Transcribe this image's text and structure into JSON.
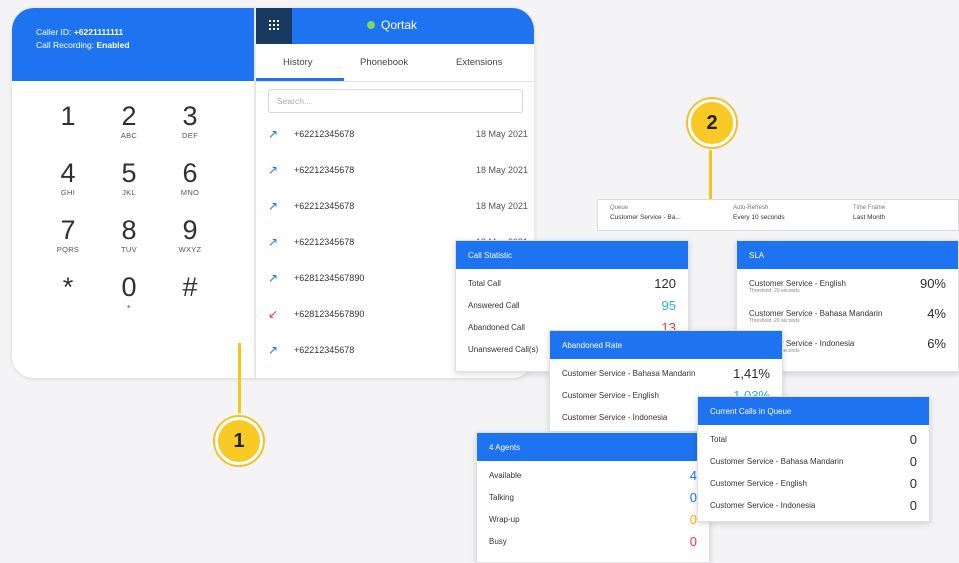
{
  "dialer": {
    "caller_id_label": "Caller ID:",
    "caller_id_value": "+6221111111",
    "recording_label": "Call Recording:",
    "recording_value": "Enabled",
    "keys": [
      {
        "n": "1",
        "l": ""
      },
      {
        "n": "2",
        "l": "ABC"
      },
      {
        "n": "3",
        "l": "DEF"
      },
      {
        "n": "4",
        "l": "GHI"
      },
      {
        "n": "5",
        "l": "JKL"
      },
      {
        "n": "6",
        "l": "MNO"
      },
      {
        "n": "7",
        "l": "PQRS"
      },
      {
        "n": "8",
        "l": "TUV"
      },
      {
        "n": "9",
        "l": "WXYZ"
      },
      {
        "n": "*",
        "l": ""
      },
      {
        "n": "0",
        "l": "+"
      },
      {
        "n": "#",
        "l": ""
      }
    ]
  },
  "app": {
    "brand": "Qortak"
  },
  "tabs": [
    "History",
    "Phonebook",
    "Extensions"
  ],
  "search": {
    "placeholder": "Search..."
  },
  "history": [
    {
      "type": "out",
      "number": "+62212345678",
      "date": "18 May 2021"
    },
    {
      "type": "out",
      "number": "+62212345678",
      "date": "18 May 2021"
    },
    {
      "type": "out",
      "number": "+62212345678",
      "date": "18 May 2021"
    },
    {
      "type": "out",
      "number": "+62212345678",
      "date": "18 May 2021"
    },
    {
      "type": "out",
      "number": "+6281234567890",
      "date": ""
    },
    {
      "type": "missed",
      "number": "+6281234567890",
      "date": ""
    },
    {
      "type": "out",
      "number": "+62212345678",
      "date": ""
    }
  ],
  "badges": {
    "one": "1",
    "two": "2"
  },
  "filters": {
    "queue_label": "Queue",
    "queue_value": "Customer Service - Ba...",
    "refresh_label": "Auto-Refresh",
    "refresh_value": "Every 10 seconds",
    "time_label": "Time Frame",
    "time_value": "Last Month"
  },
  "cards": {
    "call_statistic": {
      "title": "Call Statistic",
      "rows": [
        {
          "label": "Total Call",
          "value": "120",
          "color": "#2b2b2b"
        },
        {
          "label": "Answered Call",
          "value": "95",
          "color": "#2ab3c8"
        },
        {
          "label": "Abandoned Call",
          "value": "13",
          "color": "#e53935"
        },
        {
          "label": "Unanswered Call(s)",
          "value": "",
          "color": "#2b2b2b"
        }
      ]
    },
    "sla": {
      "title": "SLA",
      "rows": [
        {
          "label": "Customer Service - English",
          "sub": "Threshold: 20 seconds",
          "value": "90%"
        },
        {
          "label": "Customer Service - Bahasa Mandarin",
          "sub": "Threshold: 20 seconds",
          "value": "4%"
        },
        {
          "label": "Customer Service - Indonesia",
          "sub": "Threshold: 20 seconds",
          "value": "6%"
        }
      ]
    },
    "abandoned_rate": {
      "title": "Abandoned Rate",
      "rows": [
        {
          "label": "Customer Service - Bahasa Mandarin",
          "value": "1,41%",
          "color": "#2b2b2b"
        },
        {
          "label": "Customer Service - English",
          "value": "1,03%",
          "color": "#2ab3c8"
        },
        {
          "label": "Customer Service - Indonesia",
          "value": "",
          "color": "#2b2b2b"
        }
      ]
    },
    "agents": {
      "title": "4 Agents",
      "rows": [
        {
          "label": "Available",
          "value": "4",
          "color": "#1e73f0"
        },
        {
          "label": "Talking",
          "value": "0",
          "color": "#1e73f0"
        },
        {
          "label": "Wrap-up",
          "value": "0",
          "color": "#f5b400"
        },
        {
          "label": "Busy",
          "value": "0",
          "color": "#e53935"
        }
      ]
    },
    "current_calls": {
      "title": "Current Calls in Queue",
      "rows": [
        {
          "label": "Total",
          "value": "0"
        },
        {
          "label": "Customer Service - Bahasa Mandarin",
          "value": "0"
        },
        {
          "label": "Customer Service - English",
          "value": "0"
        },
        {
          "label": "Customer Service - Indonesia",
          "value": "0"
        }
      ]
    }
  }
}
